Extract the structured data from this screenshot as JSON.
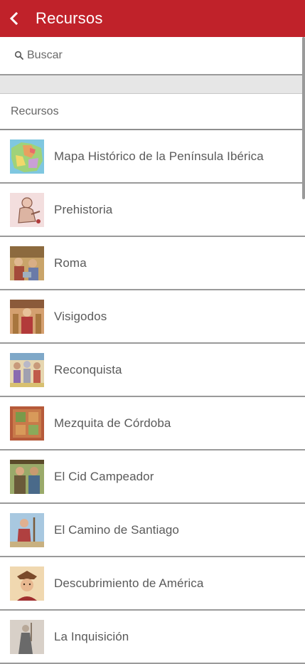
{
  "app_bar": {
    "title": "Recursos",
    "back_icon": "chevron-left-icon",
    "color": "#c0222a"
  },
  "search": {
    "placeholder": "Buscar",
    "value": "",
    "icon": "search-icon"
  },
  "section": {
    "title": "Recursos"
  },
  "items": [
    {
      "label": "Mapa Histórico de la Península Ibérica",
      "thumbnail": "map-thumbnail"
    },
    {
      "label": "Prehistoria",
      "thumbnail": "prehistoria-thumbnail"
    },
    {
      "label": "Roma",
      "thumbnail": "roma-thumbnail"
    },
    {
      "label": "Visigodos",
      "thumbnail": "visigodos-thumbnail"
    },
    {
      "label": "Reconquista",
      "thumbnail": "reconquista-thumbnail"
    },
    {
      "label": "Mezquita de Córdoba",
      "thumbnail": "mezquita-thumbnail"
    },
    {
      "label": "El Cid Campeador",
      "thumbnail": "cid-thumbnail"
    },
    {
      "label": "El Camino de Santiago",
      "thumbnail": "camino-thumbnail"
    },
    {
      "label": "Descubrimiento de América",
      "thumbnail": "america-thumbnail"
    },
    {
      "label": "La Inquisición",
      "thumbnail": "inquisicion-thumbnail"
    }
  ]
}
